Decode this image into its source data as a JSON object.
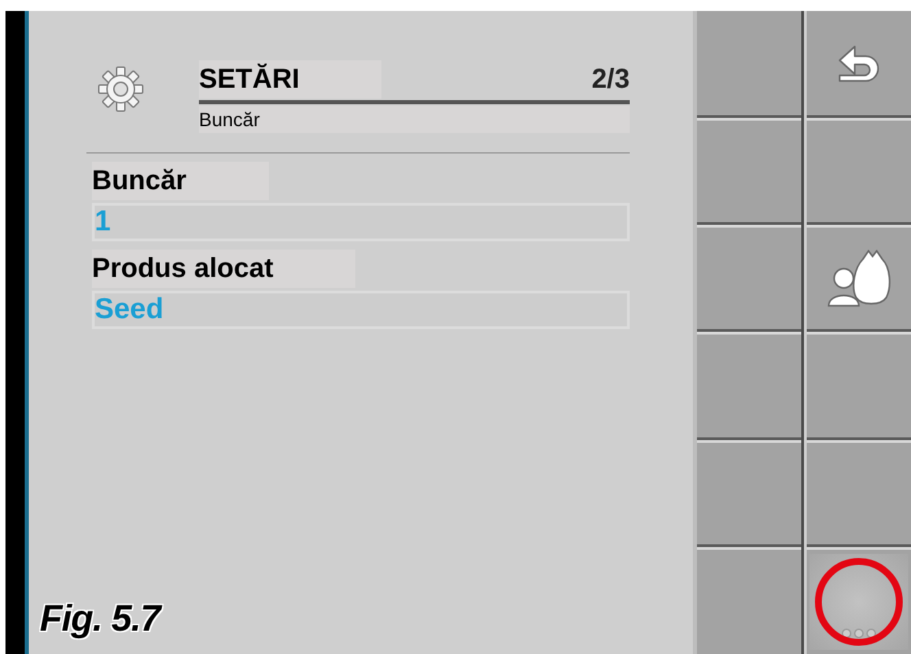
{
  "header": {
    "title": "SETĂRI",
    "page": "2/3",
    "subtitle": "Buncăr"
  },
  "fields": [
    {
      "label": "Buncăr",
      "value": "1"
    },
    {
      "label": "Produs alocat",
      "value": "Seed"
    }
  ],
  "softkeys_right": [
    {
      "kind": "back",
      "highlighted": false
    },
    {
      "kind": "empty",
      "highlighted": false
    },
    {
      "kind": "product",
      "highlighted": false
    },
    {
      "kind": "empty",
      "highlighted": false
    },
    {
      "kind": "empty",
      "highlighted": false
    },
    {
      "kind": "more",
      "highlighted": true
    }
  ],
  "figure_label": "Fig. 5.7"
}
